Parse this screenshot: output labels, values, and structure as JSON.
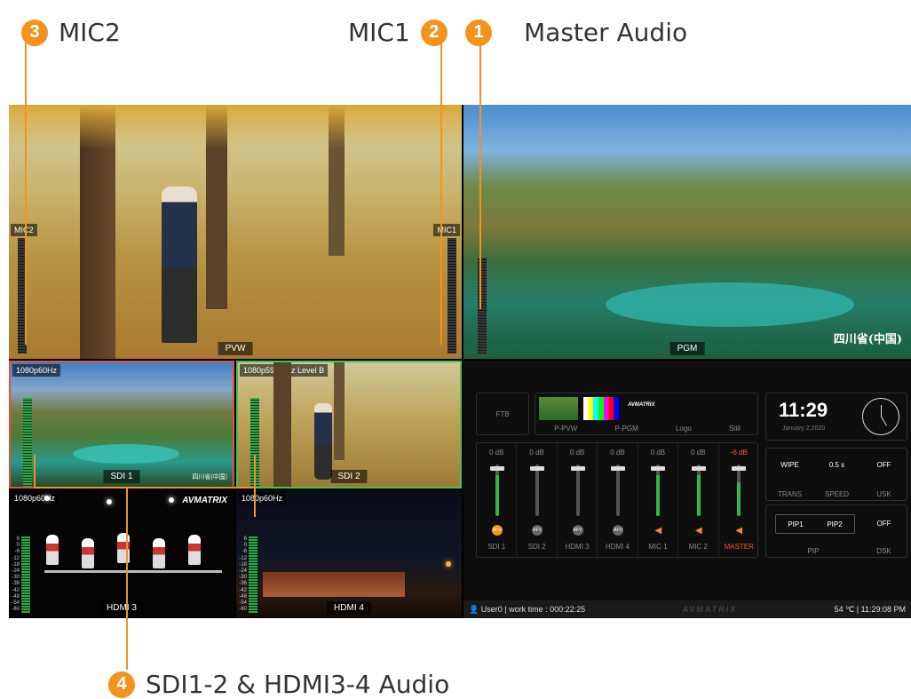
{
  "callouts": [
    {
      "num": "1",
      "label": "Master Audio"
    },
    {
      "num": "2",
      "label": "MIC1"
    },
    {
      "num": "3",
      "label": "MIC2"
    },
    {
      "num": "4",
      "label": "SDI1-2 & HDMI3-4 Audio"
    }
  ],
  "pvw": {
    "label": "PVW",
    "mic2_tag": "MIC2",
    "mic1_tag": "MIC1"
  },
  "pgm": {
    "label": "PGM",
    "watermark": "四川省(中国)"
  },
  "sources": [
    {
      "label": "SDI 1",
      "format": "1080p60Hz",
      "watermark": "四川省(中国)"
    },
    {
      "label": "SDI 2",
      "format": "1080p59.94Hz  Level B"
    },
    {
      "label": "HDMI 3",
      "format": "1080p60Hz",
      "logo": "AVMATRIX"
    },
    {
      "label": "HDMI 4",
      "format": "1080p60Hz"
    }
  ],
  "meter_scale": [
    "6",
    "0",
    "-6",
    "-12",
    "-18",
    "-24",
    "-30",
    "-36",
    "-42",
    "-48",
    "-54",
    "-60"
  ],
  "control": {
    "ftb": "FTB",
    "buttons": [
      "P-PVW",
      "P-PGM",
      "Logo",
      "Still"
    ],
    "logo_text": "AVMATRIX",
    "clock": {
      "time": "11:29",
      "date": "January 2,2020"
    },
    "trans": {
      "wipe": "WIPE",
      "speed": "0.5 s",
      "usk": "OFF",
      "lbl_trans": "TRANS",
      "lbl_speed": "SPEED",
      "lbl_usk": "USK"
    },
    "pip": {
      "pip1": "PIP1",
      "pip2": "PIP2",
      "dsk": "OFF",
      "lbl_pip": "PIP",
      "lbl_dsk": "DSK"
    },
    "channels": [
      {
        "name": "SDI 1",
        "db": "0 dB",
        "level": 0.8,
        "button": "AFV",
        "active": true
      },
      {
        "name": "SDI 2",
        "db": "0 dB",
        "level": 0.0,
        "button": "AFV",
        "active": false
      },
      {
        "name": "HDMI 3",
        "db": "0 dB",
        "level": 0.0,
        "button": "AFV",
        "active": false
      },
      {
        "name": "HDMI 4",
        "db": "0 dB",
        "level": 0.0,
        "button": "AFV",
        "active": false
      },
      {
        "name": "MIC 1",
        "db": "0 dB",
        "level": 0.8,
        "button": "speaker",
        "active": true
      },
      {
        "name": "MIC 2",
        "db": "0 dB",
        "level": 0.8,
        "button": "speaker",
        "active": true
      },
      {
        "name": "MASTER",
        "db": "-6 dB",
        "level": 0.65,
        "button": "speaker",
        "active": true
      }
    ],
    "status": {
      "user": "User0 | work time : 000:22:25",
      "brand": "AVMATRIX",
      "right": "54 ℃ | 11:29:08 PM"
    }
  },
  "colors": {
    "accent": "#f29320",
    "sdi1_border": "#e0533a",
    "sdi2_border": "#42c24a",
    "master_red": "#e65a3a",
    "fader_green": "#33b64a"
  }
}
